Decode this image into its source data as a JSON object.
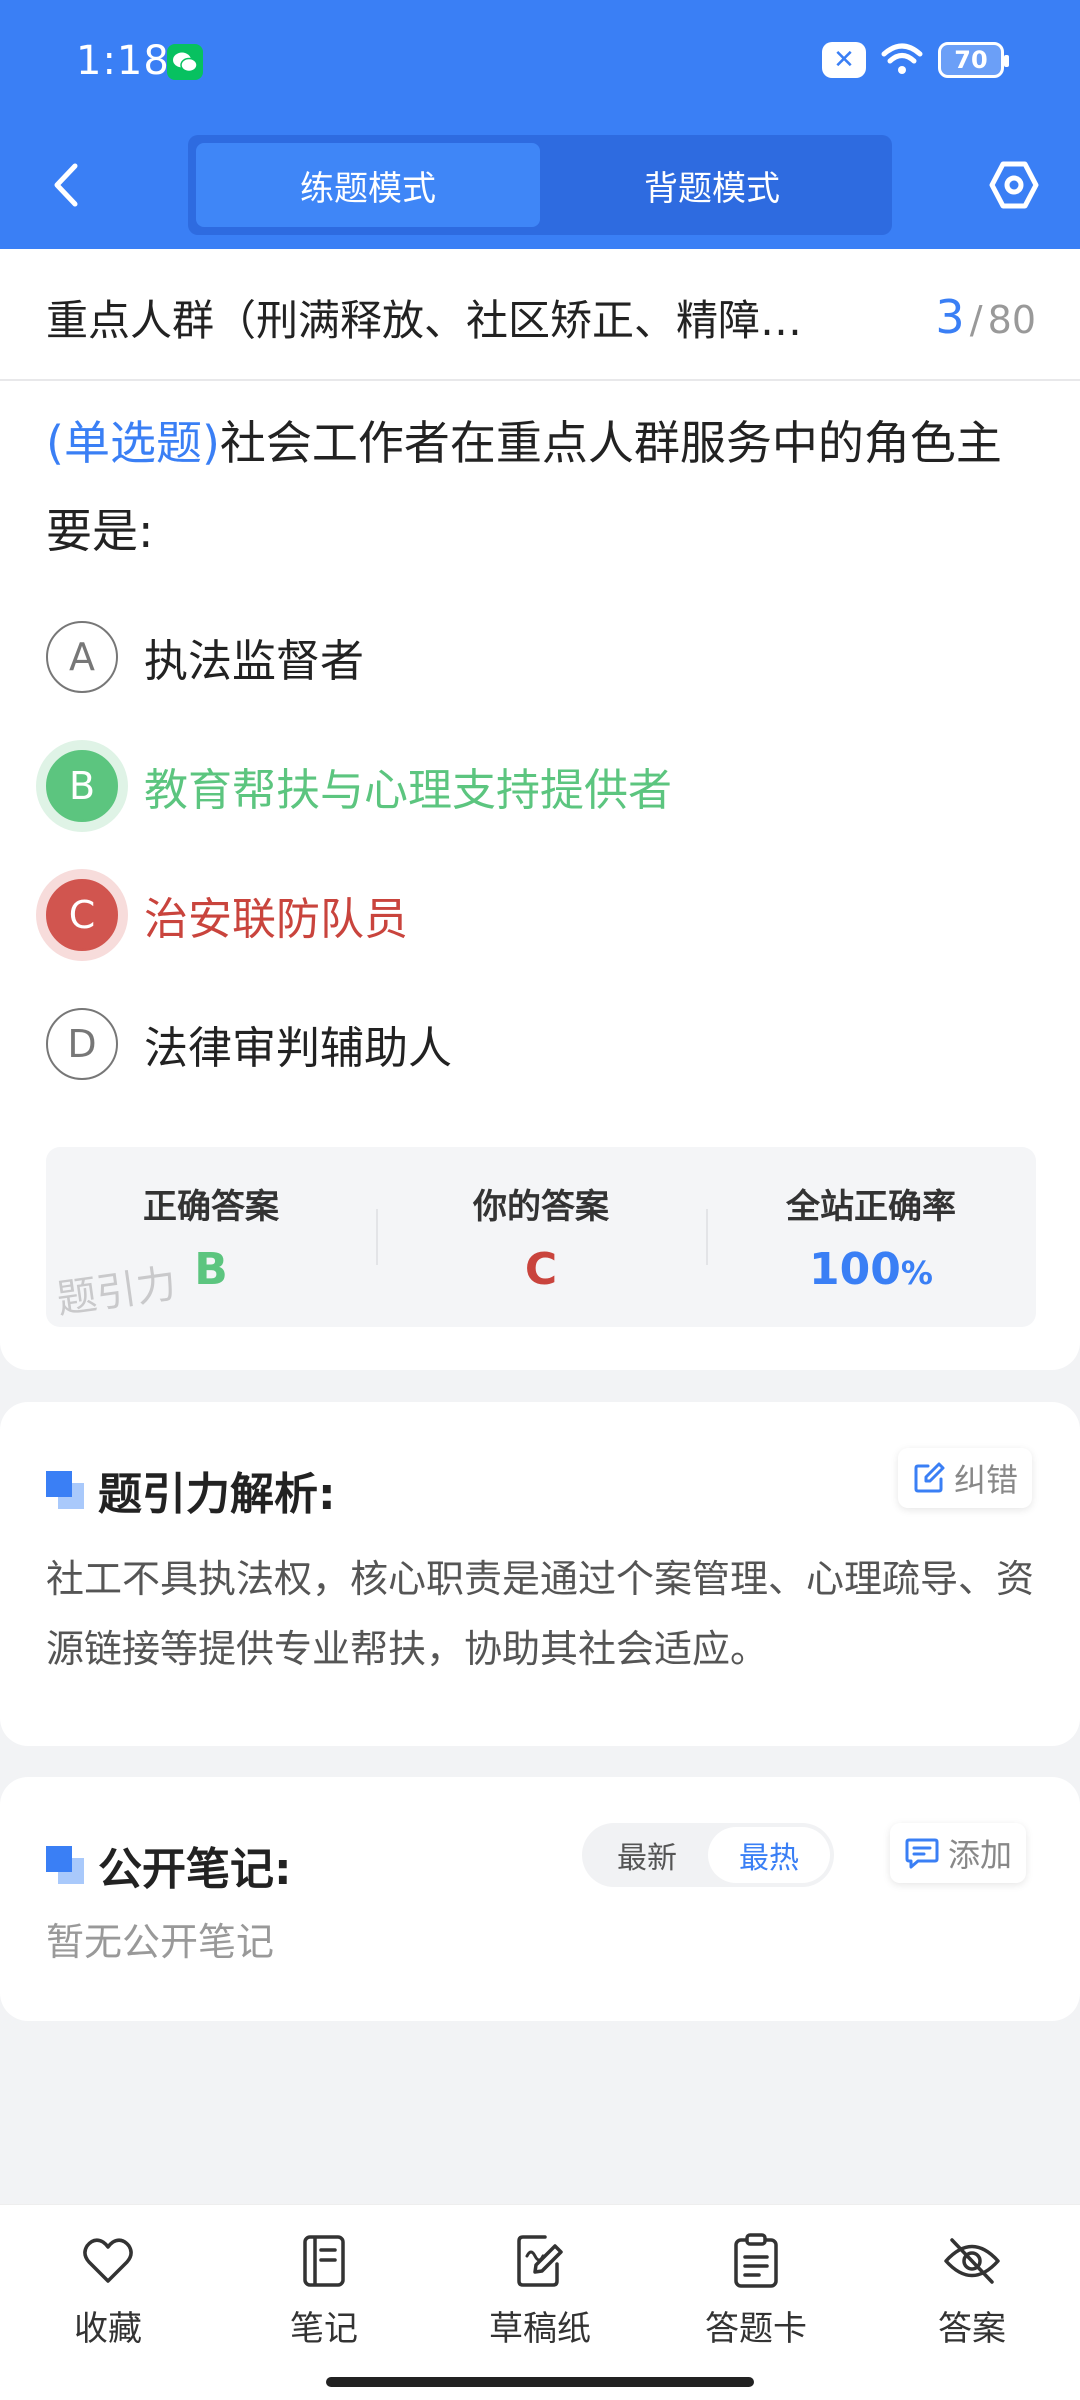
{
  "status_bar": {
    "time": "1:18",
    "battery": "70"
  },
  "nav": {
    "modes": [
      "练题模式",
      "背题模式"
    ],
    "active_mode": 0
  },
  "chapter": {
    "title": "重点人群（刑满释放、社区矫正、精障…",
    "current": "3",
    "separator": "/",
    "total": "80"
  },
  "question": {
    "type_label": "(单选题)",
    "text": "社会工作者在重点人群服务中的角色主要是:",
    "options": [
      {
        "letter": "A",
        "text": "执法监督者",
        "state": "normal"
      },
      {
        "letter": "B",
        "text": "教育帮扶与心理支持提供者",
        "state": "correct"
      },
      {
        "letter": "C",
        "text": "治安联防队员",
        "state": "wrong"
      },
      {
        "letter": "D",
        "text": "法律审判辅助人",
        "state": "normal"
      }
    ]
  },
  "answer_summary": {
    "correct_label": "正确答案",
    "correct_value": "B",
    "yours_label": "你的答案",
    "yours_value": "C",
    "rate_label": "全站正确率",
    "rate_value": "100",
    "rate_unit": "%"
  },
  "watermark": "题引力",
  "analysis": {
    "title": "题引力解析:",
    "report_label": "纠错",
    "text": "社工不具执法权，核心职责是通过个案管理、心理疏导、资源链接等提供专业帮扶，协助其社会适应。"
  },
  "notes": {
    "title": "公开笔记:",
    "sort_options": [
      "最新",
      "最热"
    ],
    "active_sort": 1,
    "add_label": "添加",
    "empty_text": "暂无公开笔记"
  },
  "bottom_bar": [
    {
      "label": "收藏",
      "icon": "heart-icon"
    },
    {
      "label": "笔记",
      "icon": "notebook-icon"
    },
    {
      "label": "草稿纸",
      "icon": "draft-paper-icon"
    },
    {
      "label": "答题卡",
      "icon": "answer-sheet-icon"
    },
    {
      "label": "答案",
      "icon": "eye-off-icon"
    }
  ],
  "colors": {
    "primary": "#3a7ff5",
    "correct": "#5cc57f",
    "wrong": "#c9443d"
  }
}
